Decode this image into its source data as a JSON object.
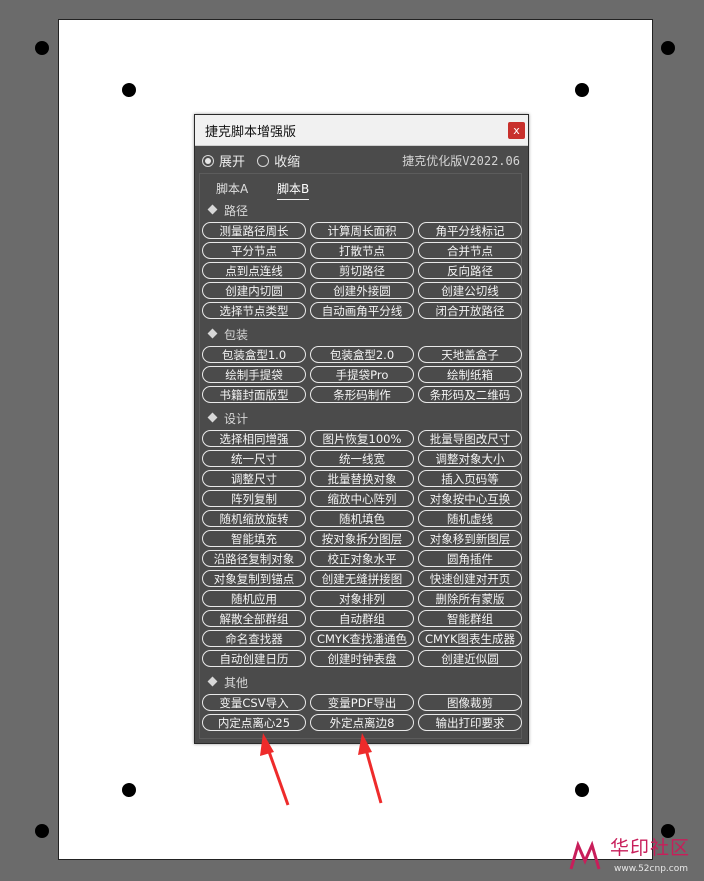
{
  "window": {
    "title": "捷克脚本增强版",
    "close_label": "x"
  },
  "options": {
    "expand_label": "展开",
    "collapse_label": "收缩",
    "version": "捷克优化版V2022.06"
  },
  "tabs": [
    {
      "label": "脚本A"
    },
    {
      "label": "脚本B"
    }
  ],
  "sections": {
    "path": {
      "title": "路径",
      "buttons": [
        "测量路径周长",
        "计算周长面积",
        "角平分线标记",
        "平分节点",
        "打散节点",
        "合并节点",
        "点到点连线",
        "剪切路径",
        "反向路径",
        "创建内切圆",
        "创建外接圆",
        "创建公切线",
        "选择节点类型",
        "自动画角平分线",
        "闭合开放路径"
      ]
    },
    "package": {
      "title": "包装",
      "buttons": [
        "包装盒型1.0",
        "包装盒型2.0",
        "天地盖盒子",
        "绘制手提袋",
        "手提袋Pro",
        "绘制纸箱",
        "书籍封面版型",
        "条形码制作",
        "条形码及二维码"
      ]
    },
    "design": {
      "title": "设计",
      "buttons": [
        "选择相同增强",
        "图片恢复100%",
        "批量导图改尺寸",
        "统一尺寸",
        "统一线宽",
        "调整对象大小",
        "调整尺寸",
        "批量替换对象",
        "插入页码等",
        "阵列复制",
        "缩放中心阵列",
        "对象按中心互换",
        "随机缩放旋转",
        "随机填色",
        "随机虚线",
        "智能填充",
        "按对象拆分图层",
        "对象移到新图层",
        "沿路径复制对象",
        "校正对象水平",
        "圆角插件",
        "对象复制到锚点",
        "创建无缝拼接图",
        "快速创建对开页",
        "随机应用",
        "对象排列",
        "删除所有蒙版",
        "解散全部群组",
        "自动群组",
        "智能群组",
        "命名查找器",
        "CMYK查找潘通色",
        "CMYK图表生成器",
        "自动创建日历",
        "创建时钟表盘",
        "创建近似圆"
      ]
    },
    "other": {
      "title": "其他",
      "buttons": [
        "变量CSV导入",
        "变量PDF导出",
        "图像裁剪",
        "内定点离心25",
        "外定点离边8",
        "输出打印要求"
      ]
    }
  },
  "watermark": {
    "text": "华印社区",
    "url": "www.52cnp.com"
  },
  "colors": {
    "panel_bg": "#4b4b4b",
    "close_red": "#c8302c",
    "arrow_red": "#ee2b2b",
    "watermark_red": "#c81e5a"
  }
}
